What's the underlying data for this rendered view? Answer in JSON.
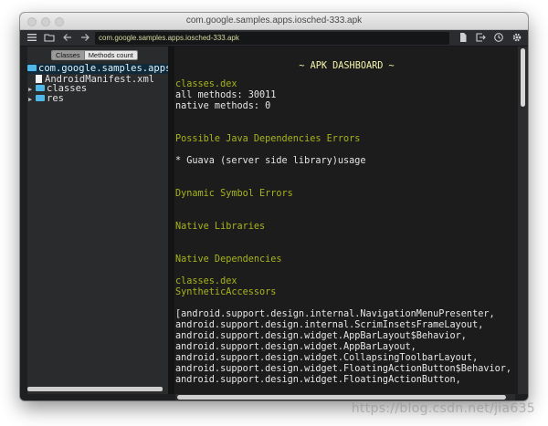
{
  "window": {
    "title": "com.google.samples.apps.iosched-333.apk"
  },
  "toolbar": {
    "path": "com.google.samples.apps.iosched-333.apk",
    "icons": [
      "menu-icon",
      "folder-icon",
      "back-arrow-icon",
      "forward-arrow-icon",
      "document-icon",
      "export-icon",
      "history-icon",
      "gear-icon"
    ]
  },
  "sidebar": {
    "tabs": [
      "Classes",
      "Methods count"
    ],
    "tree": [
      {
        "label": "com.google.samples.apps",
        "kind": "folder",
        "selected": true
      },
      {
        "label": "AndroidManifest.xml",
        "kind": "file"
      },
      {
        "label": "classes",
        "kind": "folder-collapsed"
      },
      {
        "label": "res",
        "kind": "folder-collapsed"
      }
    ]
  },
  "main": {
    "heading": "~ APK DASHBOARD ~",
    "dex_name": "classes.dex",
    "all_methods": "all methods: 30011",
    "native_methods": "native methods: 0",
    "java_dep_title": "Possible Java Dependencies Errors",
    "java_dep_item": "* Guava (server side library)usage",
    "dyn_symbol_title": "Dynamic Symbol Errors",
    "native_libs_title": "Native Libraries",
    "native_deps_title": "Native Dependencies",
    "native_deps_dex": "classes.dex",
    "synthetic_title": "SyntheticAccessors",
    "synthetic_lines": [
      "[android.support.design.internal.NavigationMenuPresenter,",
      "android.support.design.internal.ScrimInsetsFrameLayout,",
      "android.support.design.widget.AppBarLayout$Behavior,",
      "android.support.design.widget.AppBarLayout,",
      "android.support.design.widget.CollapsingToolbarLayout,",
      "android.support.design.widget.FloatingActionButton$Behavior,",
      "android.support.design.widget.FloatingActionButton,"
    ]
  },
  "watermark": "https://blog.csdn.net/jia635",
  "colors": {
    "section": "#a7b41c",
    "heading": "#f4f4aa",
    "folder": "#4fb8e8",
    "selected_row": "#0f2a3a"
  }
}
